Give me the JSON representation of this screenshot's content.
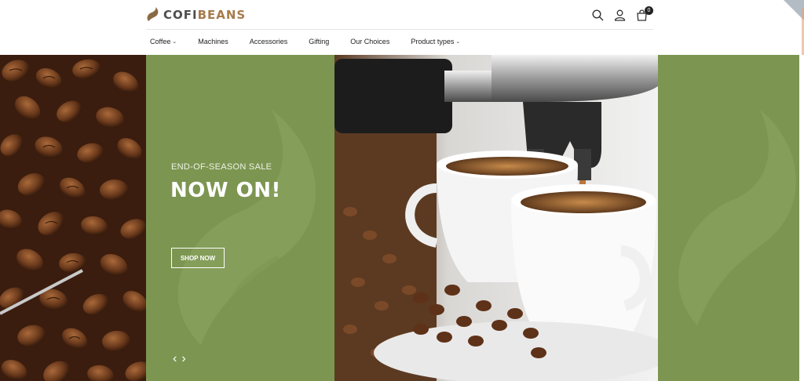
{
  "brand": {
    "name_part1": "COFI",
    "name_part2": "BEANS",
    "accent_color": "#a77b4b"
  },
  "header_icons": [
    "search-icon",
    "user-icon",
    "shopping-bag-icon"
  ],
  "cart": {
    "count": "0"
  },
  "nav": {
    "items": [
      {
        "label": "Coffee",
        "has_dropdown": true
      },
      {
        "label": "Machines",
        "has_dropdown": false
      },
      {
        "label": "Accessories",
        "has_dropdown": false
      },
      {
        "label": "Gifting",
        "has_dropdown": false
      },
      {
        "label": "Our Choices",
        "has_dropdown": false
      },
      {
        "label": "Product types",
        "has_dropdown": true
      }
    ]
  },
  "hero": {
    "subtitle": "END-OF-SEASON SALE",
    "title": "NOW ON!",
    "button_label": "SHOP NOW",
    "prev_arrow": "‹",
    "next_arrow": "›",
    "panel_color": "#7c9651"
  }
}
